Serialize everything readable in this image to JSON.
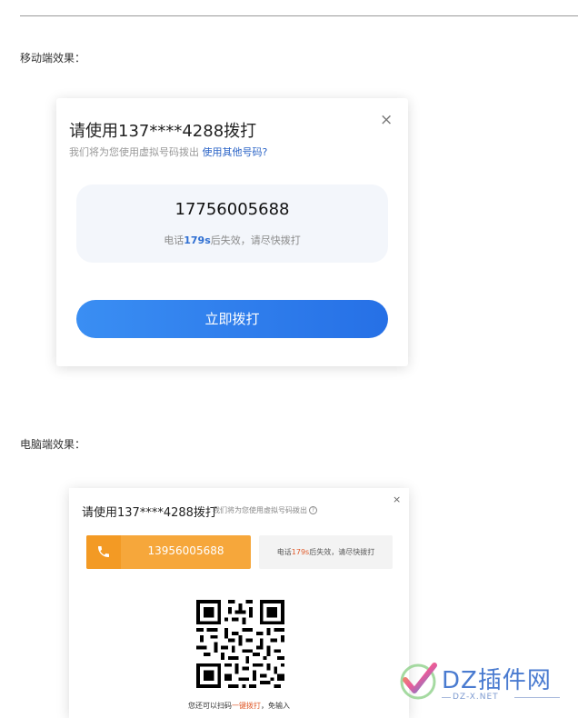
{
  "labels": {
    "mobile": "移动端效果：",
    "pc": "电脑端效果："
  },
  "mobile_dialog": {
    "title": "请使用137****4288拨打",
    "subtitle": "我们将为您使用虚拟号码拨出",
    "link": "使用其他号码?",
    "number": "17756005688",
    "expire_prefix": "电话",
    "expire_seconds": "179s",
    "expire_suffix": "后失效，请尽快拨打",
    "call_button": "立即拨打",
    "close": "×"
  },
  "pc_dialog": {
    "title": "请使用137****4288拨打",
    "hint": "我们将为您使用虚拟号码拨出",
    "help": "?",
    "close": "×",
    "number": "13956005688",
    "expire_prefix": "电话",
    "expire_seconds": "179s",
    "expire_suffix": "后失效，请尽快拨打",
    "scan_prefix": "您还可以扫码",
    "scan_highlight": "一键拨打",
    "scan_suffix": "，免输入"
  },
  "watermark": {
    "brand": "DZ插件网",
    "url": "DZ-X.NET"
  },
  "colors": {
    "mobile_button": "#2670e6",
    "mobile_accent": "#2f6fd2",
    "pc_number_bar": "#f6a73b",
    "pc_highlight": "#e05a2a",
    "watermark": "#4a7bd0"
  },
  "icons": {
    "close": "close-icon",
    "phone": "phone-icon",
    "help": "help-icon",
    "qr": "qr-code",
    "watermark_logo": "checkmark-logo"
  }
}
